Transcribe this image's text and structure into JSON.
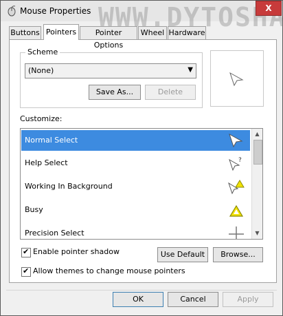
{
  "window": {
    "title": "Mouse Properties",
    "watermark": "WWW.DYTOSHARE.US",
    "close_label": "X"
  },
  "tabs": [
    {
      "label": "Buttons"
    },
    {
      "label": "Pointers"
    },
    {
      "label": "Pointer Options"
    },
    {
      "label": "Wheel"
    },
    {
      "label": "Hardware"
    }
  ],
  "scheme": {
    "label": "Scheme",
    "selected": "(None)",
    "save_as_label": "Save As...",
    "delete_label": "Delete"
  },
  "customize": {
    "label": "Customize:",
    "items": [
      {
        "label": "Normal Select",
        "icon": "arrow-cursor-icon"
      },
      {
        "label": "Help Select",
        "icon": "help-cursor-icon"
      },
      {
        "label": "Working In Background",
        "icon": "working-cursor-icon"
      },
      {
        "label": "Busy",
        "icon": "busy-cursor-icon"
      },
      {
        "label": "Precision Select",
        "icon": "crosshair-cursor-icon"
      }
    ]
  },
  "options": {
    "shadow_label": "Enable pointer shadow",
    "themes_label": "Allow themes to change mouse pointers",
    "use_default_label": "Use Default",
    "browse_label": "Browse..."
  },
  "footer": {
    "ok_label": "OK",
    "cancel_label": "Cancel",
    "apply_label": "Apply"
  },
  "colors": {
    "selection": "#3d8be0",
    "close": "#c73b3b"
  }
}
